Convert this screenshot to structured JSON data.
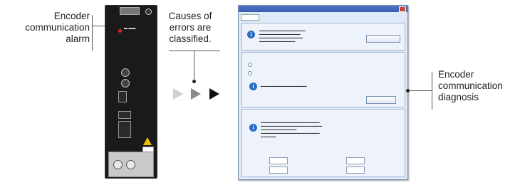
{
  "captions": {
    "left": [
      "Encoder",
      "communication",
      "alarm"
    ],
    "middle": [
      "Causes of",
      "errors are",
      "classified."
    ],
    "right": [
      "Encoder",
      "communication",
      "diagnosis"
    ]
  },
  "colors": {
    "arrow_light": "#c8c8c8",
    "arrow_mid": "#8a8a8a",
    "arrow_dark": "#111111",
    "window_bg": "#dfe8f6",
    "title_bar": "#3a5fb0",
    "info_icon": "#2a6bc7",
    "warning": "#f0c000"
  },
  "icons": {
    "info": "info-icon",
    "warning": "warning-icon",
    "arrow": "arrow-right-icon"
  }
}
